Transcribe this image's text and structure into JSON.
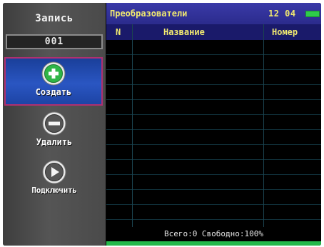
{
  "sidebar": {
    "record_label": "Запись",
    "record_value": "001",
    "buttons": [
      {
        "label": "Создать",
        "icon": "plus-circle-icon",
        "selected": true
      },
      {
        "label": "Удалить",
        "icon": "minus-circle-icon",
        "selected": false
      },
      {
        "label": "Подключить",
        "icon": "play-circle-icon",
        "selected": false
      }
    ]
  },
  "panel": {
    "title": "Преобразователи",
    "clock": "12 04",
    "battery_color": "#2ecc4a",
    "columns": [
      "N",
      "Название",
      "Номер"
    ],
    "rows": [],
    "footer": "Всего:0 Свободно:100%"
  }
}
